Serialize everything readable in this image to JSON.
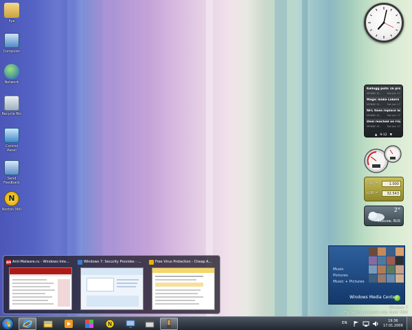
{
  "desktop": {
    "icons": [
      {
        "label": "Ilya",
        "icon": "user-folder-icon"
      },
      {
        "label": "Computer",
        "icon": "computer-icon"
      },
      {
        "label": "Network",
        "icon": "network-icon"
      },
      {
        "label": "Recycle Bin",
        "icon": "recycle-bin-icon"
      },
      {
        "label": "Control Panel",
        "icon": "control-panel-icon"
      },
      {
        "label": "Send Feedback",
        "icon": "send-feedback-icon"
      },
      {
        "label": "Norton 360",
        "icon": "norton-icon"
      }
    ]
  },
  "gadgets": {
    "feed": {
      "items": [
        {
          "title": "Kellogg pulls 16 prod...",
          "source": "MSNBC N...",
          "date": "Sat Jan 17"
        },
        {
          "title": "Magic make Lakers ...",
          "source": "MSNBC N...",
          "date": "Sat Jan 17"
        },
        {
          "title": "NFL fines replace Gr...",
          "source": "MSNBC N...",
          "date": "Sat Jan 17"
        },
        {
          "title": "Deal reached on Flig...",
          "source": "MSNBC N...",
          "date": "Sat Jan 17"
        }
      ],
      "range": "9-12"
    },
    "currency": {
      "rows": [
        {
          "label": "USD =",
          "value": "1.000"
        },
        {
          "label": "RUB =",
          "value": "32.543"
        }
      ]
    },
    "weather": {
      "temp": "2°",
      "city": "Moscow, RUS"
    },
    "media_center": {
      "menu": [
        "Music",
        "Pictures",
        "Music + Pictures"
      ],
      "title": "Windows Media Center"
    }
  },
  "watermark": {
    "line1": "Windows 7",
    "line2": "For testing purposes only. Build 7000"
  },
  "thumbnails": [
    {
      "title": "Anti-Malware.ru - Windows Inte...",
      "icon": "anti-malware-icon",
      "icon_text": "AM",
      "icon_color": "#d8251b"
    },
    {
      "title": "Windows 7: Security Provides - ...",
      "icon": "windows-icon",
      "icon_text": "",
      "icon_color": "#3d7bd1"
    },
    {
      "title": "Free Virus Protection - Cheap A...",
      "icon": "norton-icon",
      "icon_text": "",
      "icon_color": "#e8b400"
    }
  ],
  "taskbar": {
    "buttons": [
      {
        "name": "internet-explorer-icon",
        "active": true
      },
      {
        "name": "windows-explorer-icon",
        "active": false
      },
      {
        "name": "media-player-icon",
        "active": false
      },
      {
        "name": "media-center-icon",
        "active": false
      },
      {
        "name": "norton-icon",
        "active": false
      },
      {
        "name": "remote-desktop-icon",
        "active": false
      },
      {
        "name": "movie-maker-icon",
        "active": false
      },
      {
        "name": "paint-icon",
        "active": true
      }
    ],
    "language": "EN",
    "time": "19:36",
    "date": "17.01.2009"
  },
  "colors": {
    "taskbar": "#2a323c",
    "media_center": "#1f4a84",
    "currency": "#b1a842",
    "accent_red": "#d8251b"
  }
}
